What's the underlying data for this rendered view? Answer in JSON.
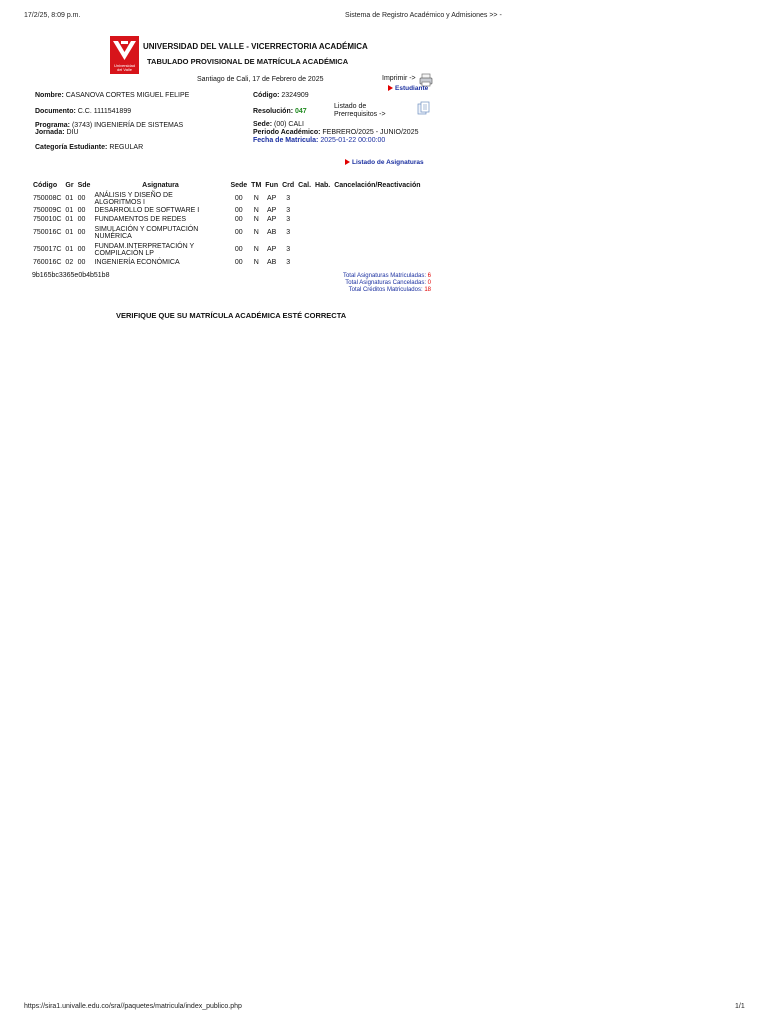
{
  "print_header": {
    "datetime": "17/2/25, 8:09 p.m.",
    "title": "Sistema de Registro Académico y Admisiones >> -"
  },
  "logo": {
    "text_line1": "Universidad",
    "text_line2": "del Valle"
  },
  "header": {
    "university": "UNIVERSIDAD DEL VALLE - VICERRECTORIA ACADÉMICA",
    "document_title": "TABULADO PROVISIONAL DE MATRÍCULA ACADÉMICA",
    "place_date": "Santiago de Cali, 17 de Febrero de 2025",
    "print_label": "Imprimir ->",
    "student_link": "Estudiante",
    "prereq_label_line1": "Listado de",
    "prereq_label_line2": "Prerrequisitos ->"
  },
  "student": {
    "name_label": "Nombre:",
    "name": "CASANOVA CORTES MIGUEL FELIPE",
    "code_label": "Código:",
    "code": "2324909",
    "document_label": "Documento:",
    "document": "C.C. 1111541899",
    "resolution_label": "Resolución:",
    "resolution": "047",
    "program_label": "Programa:",
    "program": "(3743) INGENIERÍA DE SISTEMAS",
    "shift_label": "Jornada:",
    "shift": "DIU",
    "campus_label": "Sede:",
    "campus": "(00) CALI",
    "period_label": "Periodo Académico:",
    "period": "FEBRERO/2025 - JUNIO/2025",
    "enroll_date_label": "Fecha de Matricula:",
    "enroll_date": "2025-01-22 00:00:00",
    "category_label": "Categoría Estudiante:",
    "category": "REGULAR"
  },
  "courses_link": "Listado de Asignaturas",
  "table": {
    "headers": [
      "Código",
      "Gr",
      "Sde",
      "Asignatura",
      "Sede",
      "TM",
      "Fun",
      "Crd",
      "Cal.",
      "Hab.",
      "Cancelación/Reactivación"
    ],
    "rows": [
      {
        "code": "750008C",
        "gr": "01",
        "sde": "00",
        "name1": "ANÁLISIS Y DISEÑO DE",
        "name2": "ALGORITMOS I",
        "sede": "00",
        "tm": "N",
        "fun": "AP",
        "crd": "3"
      },
      {
        "code": "750009C",
        "gr": "01",
        "sde": "00",
        "name1": "DESARROLLO DE SOFTWARE I",
        "name2": "",
        "sede": "00",
        "tm": "N",
        "fun": "AP",
        "crd": "3"
      },
      {
        "code": "750010C",
        "gr": "01",
        "sde": "00",
        "name1": "FUNDAMENTOS DE REDES",
        "name2": "",
        "sede": "00",
        "tm": "N",
        "fun": "AP",
        "crd": "3"
      },
      {
        "code": "750016C",
        "gr": "01",
        "sde": "00",
        "name1": "SIMULACIÓN Y COMPUTACIÓN",
        "name2": "NUMÉRICA",
        "sede": "00",
        "tm": "N",
        "fun": "AB",
        "crd": "3"
      },
      {
        "code": "750017C",
        "gr": "01",
        "sde": "00",
        "name1": "FUNDAM.INTERPRETACIÓN Y",
        "name2": "COMPILACIÓN LP",
        "sede": "00",
        "tm": "N",
        "fun": "AP",
        "crd": "3"
      },
      {
        "code": "760016C",
        "gr": "02",
        "sde": "00",
        "name1": "INGENIERÍA ECONÓMICA",
        "name2": "",
        "sede": "00",
        "tm": "N",
        "fun": "AB",
        "crd": "3"
      }
    ]
  },
  "hash": "9b165bc3365e0b4b51b8",
  "totals": {
    "enrolled_label": "Total Asignaturas Matriculadas:",
    "enrolled": "6",
    "cancelled_label": "Total Asignaturas Canceladas:",
    "cancelled": "0",
    "credits_label": "Total Créditos Matriculados:",
    "credits": "18"
  },
  "verify_message": "VERIFIQUE QUE SU MATRÍCULA ACADÉMICA ESTÉ CORRECTA",
  "footer": {
    "url": "https://sira1.univalle.edu.co/sra//paquetes/matricula/index_publico.php",
    "page": "1/1"
  },
  "colors": {
    "brand_red": "#d7141a",
    "link_blue": "#1a2fa0",
    "resolution_green": "#1f8a1f",
    "total_red": "#e00000"
  }
}
